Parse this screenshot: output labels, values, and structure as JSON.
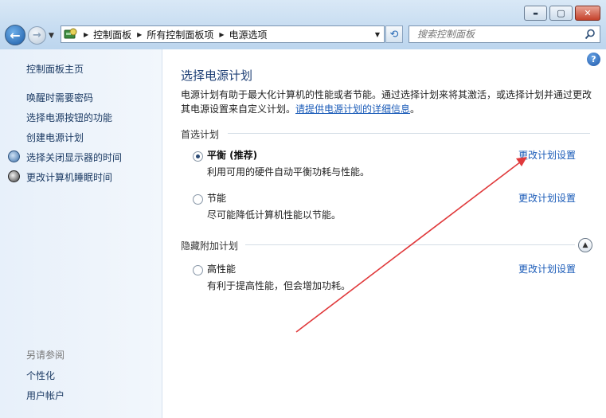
{
  "window": {
    "minimize_glyph": "▬",
    "maximize_glyph": "▢",
    "close_glyph": "✕"
  },
  "nav": {
    "breadcrumbs": [
      "控制面板",
      "所有控制面板项",
      "电源选项"
    ]
  },
  "search": {
    "placeholder": "搜索控制面板"
  },
  "sidebar": {
    "home": "控制面板主页",
    "links": [
      "唤醒时需要密码",
      "选择电源按钮的功能",
      "创建电源计划",
      "选择关闭显示器的时间",
      "更改计算机睡眠时间"
    ],
    "see_also_label": "另请参阅",
    "see_also": [
      "个性化",
      "用户帐户"
    ]
  },
  "main": {
    "title": "选择电源计划",
    "intro_text": "电源计划有助于最大化计算机的性能或者节能。通过选择计划来将其激活，或选择计划并通过更改其电源设置来自定义计划。",
    "intro_link": "请提供电源计划的详细信息",
    "intro_end": "。",
    "preferred_label": "首选计划",
    "hidden_label": "隐藏附加计划",
    "plans": [
      {
        "name": "平衡 (推荐)",
        "desc": "利用可用的硬件自动平衡功耗与性能。",
        "link": "更改计划设置",
        "selected": true
      },
      {
        "name": "节能",
        "desc": "尽可能降低计算机性能以节能。",
        "link": "更改计划设置",
        "selected": false
      },
      {
        "name": "高性能",
        "desc": "有利于提高性能，但会增加功耗。",
        "link": "更改计划设置",
        "selected": false
      }
    ]
  },
  "annotation": {
    "arrow_color": "#e0393b"
  }
}
